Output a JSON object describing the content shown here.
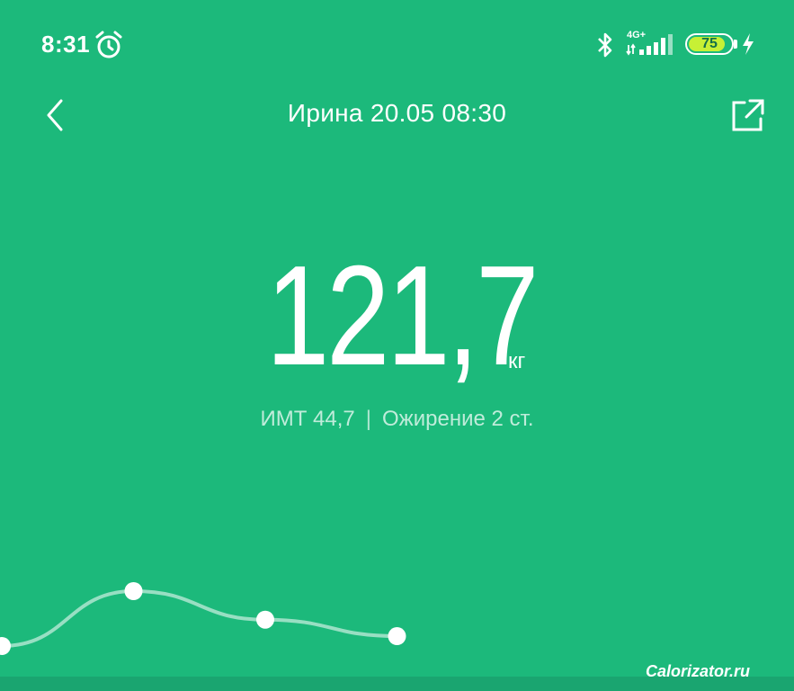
{
  "status_bar": {
    "time": "8:31",
    "network": "4G+",
    "battery": "75",
    "icons": [
      "alarm-icon",
      "bluetooth-icon",
      "signal-icon",
      "battery-icon",
      "charging-icon"
    ]
  },
  "header": {
    "title": "Ирина 20.05 08:30",
    "back_icon": "chevron-left-icon",
    "share_icon": "share-icon"
  },
  "measurement": {
    "weight": "121,7",
    "unit": "кг",
    "bmi": "ИМТ 44,7",
    "separator": "|",
    "category": "Ожирение 2 ст."
  },
  "chart_data": {
    "type": "line",
    "x": [
      0,
      1,
      2,
      3
    ],
    "series": [
      {
        "values": [
          0.0,
          1.0,
          0.48,
          0.18
        ]
      }
    ],
    "selected_index": 3
  },
  "colors": {
    "background": "#1cb97b",
    "battery_fill": "#c7f035",
    "line": "rgba(255,255,255,0.55)"
  },
  "watermark": "Calorizator.ru"
}
